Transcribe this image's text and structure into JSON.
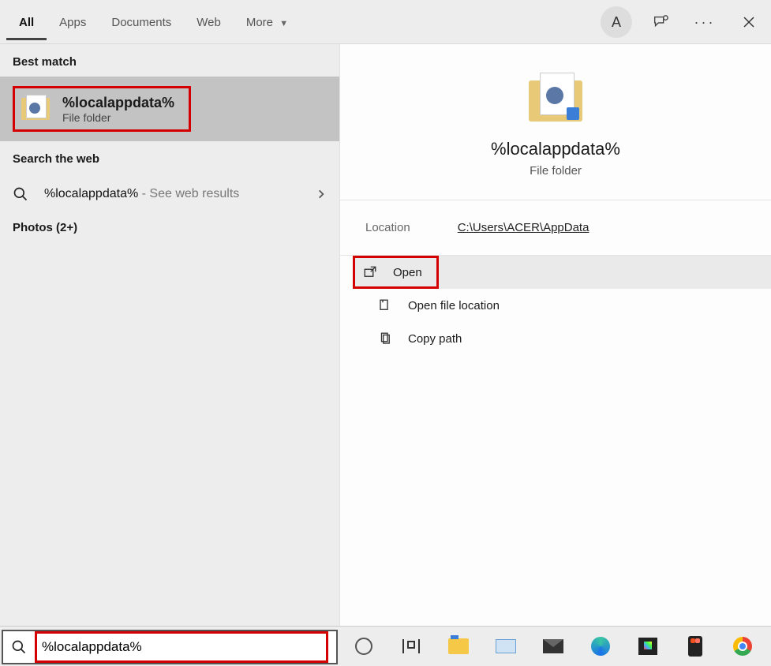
{
  "tabs": {
    "all": "All",
    "apps": "Apps",
    "documents": "Documents",
    "web": "Web",
    "more": "More"
  },
  "avatar_letter": "A",
  "sections": {
    "best_match": "Best match",
    "search_web": "Search the web",
    "photos": "Photos (2+)"
  },
  "best_match": {
    "title": "%localappdata%",
    "subtitle": "File folder"
  },
  "web_result": {
    "query": "%localappdata%",
    "suffix": " - See web results"
  },
  "preview": {
    "title": "%localappdata%",
    "subtitle": "File folder",
    "location_label": "Location",
    "location_value": "C:\\Users\\ACER\\AppData"
  },
  "actions": {
    "open": "Open",
    "open_file_location": "Open file location",
    "copy_path": "Copy path"
  },
  "search_value": "%localappdata%",
  "taskbar_apps": [
    "cortana",
    "slider",
    "explorer",
    "keyboard",
    "mail",
    "edge",
    "store",
    "figma",
    "chrome"
  ]
}
